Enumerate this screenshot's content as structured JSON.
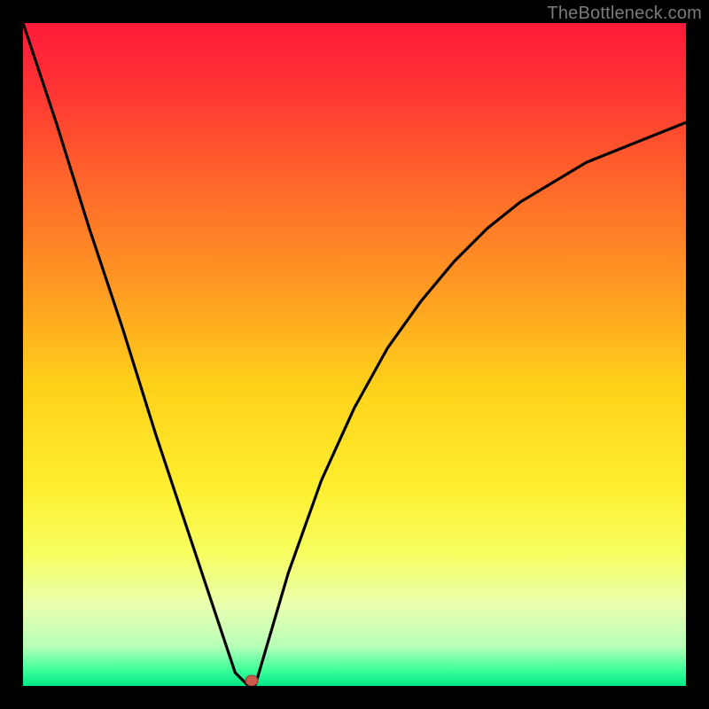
{
  "watermark": "TheBottleneck.com",
  "chart_data": {
    "type": "line",
    "title": "",
    "xlabel": "",
    "ylabel": "",
    "xlim": [
      0,
      100
    ],
    "ylim": [
      0,
      100
    ],
    "x": [
      0,
      5,
      10,
      15,
      20,
      25,
      28,
      30,
      32,
      34,
      35,
      40,
      45,
      50,
      55,
      60,
      65,
      70,
      75,
      80,
      85,
      90,
      95,
      100
    ],
    "values": [
      100,
      85,
      69,
      54,
      38,
      23,
      14,
      8,
      2,
      0,
      0,
      17,
      31,
      42,
      51,
      58,
      64,
      69,
      73,
      76,
      79,
      81,
      83,
      85
    ],
    "marker": {
      "x": 34.5,
      "y": 0.8
    },
    "gradient_stops": [
      {
        "offset": 0.0,
        "color": "#ff1a3a"
      },
      {
        "offset": 0.1,
        "color": "#ff3433"
      },
      {
        "offset": 0.25,
        "color": "#ff6a2a"
      },
      {
        "offset": 0.4,
        "color": "#ff9a22"
      },
      {
        "offset": 0.55,
        "color": "#ffd21a"
      },
      {
        "offset": 0.7,
        "color": "#ffee30"
      },
      {
        "offset": 0.8,
        "color": "#f7ff60"
      },
      {
        "offset": 0.88,
        "color": "#e8ffb0"
      },
      {
        "offset": 0.94,
        "color": "#b8ffb8"
      },
      {
        "offset": 0.975,
        "color": "#40ff9a"
      },
      {
        "offset": 1.0,
        "color": "#00e888"
      }
    ]
  }
}
